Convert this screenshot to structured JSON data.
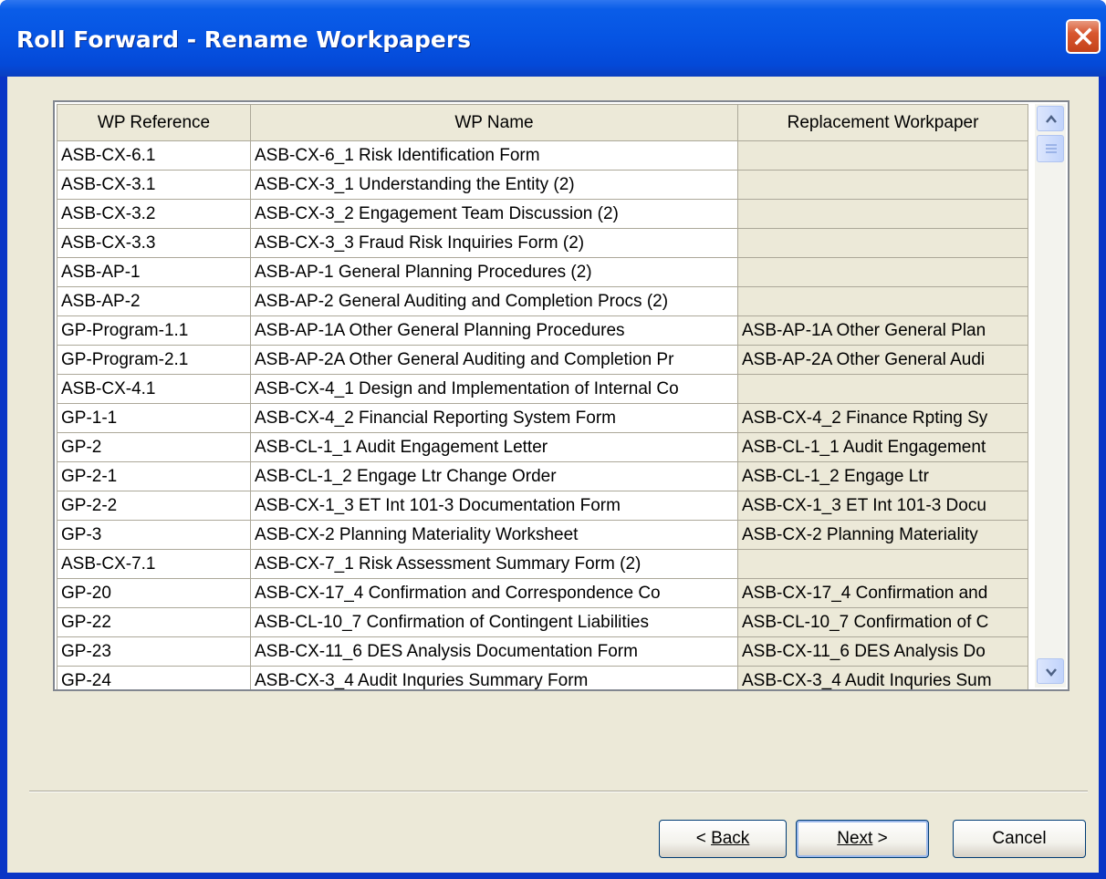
{
  "window": {
    "title": "Roll Forward - Rename Workpapers"
  },
  "table": {
    "columns": [
      "WP Reference",
      "WP Name",
      "Replacement Workpaper"
    ],
    "rows": [
      [
        "ASB-CX-6.1",
        "ASB-CX-6_1 Risk Identification Form",
        ""
      ],
      [
        "ASB-CX-3.1",
        "ASB-CX-3_1 Understanding the Entity (2)",
        ""
      ],
      [
        "ASB-CX-3.2",
        "ASB-CX-3_2 Engagement Team Discussion (2)",
        ""
      ],
      [
        "ASB-CX-3.3",
        "ASB-CX-3_3 Fraud Risk Inquiries Form (2)",
        ""
      ],
      [
        "ASB-AP-1",
        "ASB-AP-1 General Planning Procedures (2)",
        ""
      ],
      [
        "ASB-AP-2",
        "ASB-AP-2 General Auditing and Completion Procs (2)",
        ""
      ],
      [
        "GP-Program-1.1",
        "ASB-AP-1A Other General Planning Procedures",
        "ASB-AP-1A Other General Plan"
      ],
      [
        "GP-Program-2.1",
        "ASB-AP-2A Other General Auditing and Completion Pr",
        "ASB-AP-2A Other General Audi"
      ],
      [
        "ASB-CX-4.1",
        "ASB-CX-4_1 Design and Implementation of Internal Co",
        ""
      ],
      [
        "GP-1-1",
        "ASB-CX-4_2 Financial Reporting System Form",
        "ASB-CX-4_2 Finance Rpting Sy"
      ],
      [
        "GP-2",
        "ASB-CL-1_1 Audit Engagement Letter",
        "ASB-CL-1_1 Audit Engagement"
      ],
      [
        "GP-2-1",
        "ASB-CL-1_2 Engage Ltr Change Order",
        "ASB-CL-1_2 Engage Ltr"
      ],
      [
        "GP-2-2",
        "ASB-CX-1_3 ET Int 101-3 Documentation Form",
        "ASB-CX-1_3 ET Int 101-3 Docu"
      ],
      [
        "GP-3",
        "ASB-CX-2 Planning Materiality Worksheet",
        "ASB-CX-2 Planning Materiality"
      ],
      [
        "ASB-CX-7.1",
        "ASB-CX-7_1 Risk Assessment Summary Form (2)",
        ""
      ],
      [
        "GP-20",
        "ASB-CX-17_4 Confirmation and Correspondence Co",
        "ASB-CX-17_4 Confirmation and"
      ],
      [
        "GP-22",
        "ASB-CL-10_7 Confirmation of Contingent Liabilities",
        "ASB-CL-10_7 Confirmation of C"
      ],
      [
        "GP-23",
        "ASB-CX-11_6 DES Analysis Documentation Form",
        "ASB-CX-11_6 DES Analysis Do"
      ],
      [
        "GP-24",
        "ASB-CX-3_4 Audit Inquries Summary Form",
        "ASB-CX-3_4 Audit Inquries Sum"
      ]
    ]
  },
  "buttons": {
    "back": "Back",
    "next": "Next",
    "cancel": "Cancel"
  },
  "icons": {
    "close": "close-icon",
    "scroll_up": "scroll-up-arrow-icon",
    "scroll_down": "scroll-down-arrow-icon"
  },
  "colors": {
    "titlebar": "#0654E3",
    "dialog_bg": "#ECE9D8",
    "close_button": "#D8572F"
  }
}
